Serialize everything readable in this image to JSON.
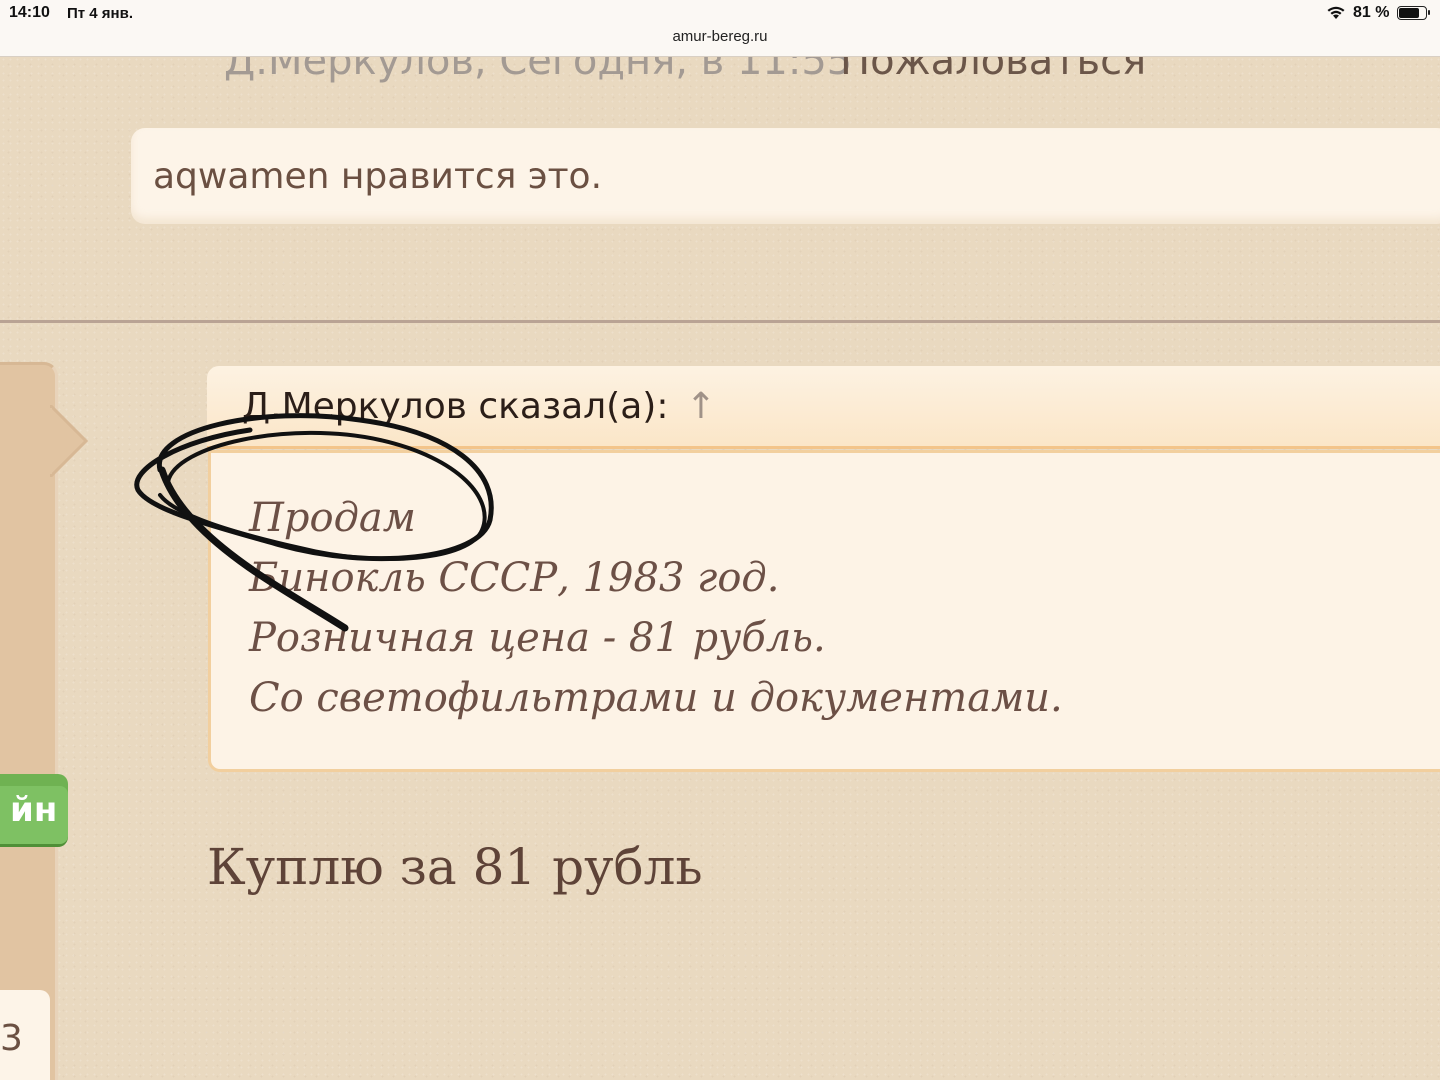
{
  "status_bar": {
    "time": "14:10",
    "date": "Пт 4 янв.",
    "url": "amur-bereg.ru",
    "battery_percent": "81 %",
    "battery_level": 0.81
  },
  "post_meta": {
    "author_time": "Д.Меркулов, Сегодня, в 11:55",
    "report_link": "Пожаловаться"
  },
  "likes": {
    "text": "aqwamen нравится это."
  },
  "sidebar": {
    "online_label": "йн",
    "counter": "3"
  },
  "quote": {
    "author_label": "Д.Меркулов сказал(а):",
    "jump_arrow": "↑",
    "lines": [
      "Продам",
      "Бинокль СССР, 1983 год.",
      "Розничная цена - 81 рубль.",
      "Со светофильтрами и документами."
    ]
  },
  "reply": {
    "text": "Куплю за 81 рубль"
  },
  "colors": {
    "page_bg": "#e9d9c0",
    "card_bg": "#fdf4e8",
    "online_green": "#7ec163",
    "text_brown": "#6b5042"
  }
}
